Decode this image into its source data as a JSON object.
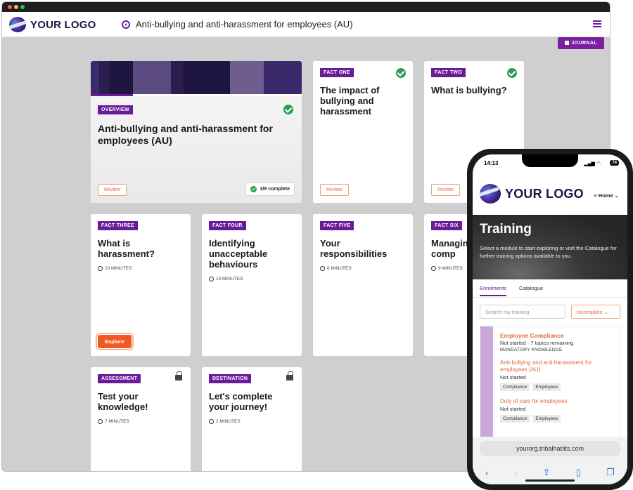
{
  "app": {
    "logo_text": "YOUR LOGO",
    "course_title": "Anti-bullying and anti-harassment for employees (AU)",
    "journal_label": "JOURNAL"
  },
  "cards": [
    {
      "tag": "OVERVIEW",
      "title": "Anti-bullying and anti-harassment for employees (AU)",
      "action": "Review",
      "status": "3/9 complete"
    },
    {
      "tag": "FACT ONE",
      "title": "The impact of bullying and harassment",
      "action": "Review"
    },
    {
      "tag": "FACT TWO",
      "title": "What is bullying?",
      "action": "Review"
    },
    {
      "tag": "FACT THREE",
      "title": "What is harassment?",
      "duration": "10 MINUTES",
      "action": "Explore"
    },
    {
      "tag": "FACT FOUR",
      "title": "Identifying unacceptable behaviours",
      "duration": "10 MINUTES"
    },
    {
      "tag": "FACT FIVE",
      "title": "Your responsibilities",
      "duration": "6 MINUTES"
    },
    {
      "tag": "FACT SIX",
      "title": "Managing and comp",
      "duration": "9 MINUTES"
    },
    {
      "tag": "ASSESSMENT",
      "title": "Test your knowledge!",
      "duration": "7 MINUTES"
    },
    {
      "tag": "DESTINATION",
      "title": "Let's complete your journey!",
      "duration": "2 MINUTES"
    }
  ],
  "phone": {
    "time": "14:13",
    "battery": "74",
    "logo_text": "YOUR LOGO",
    "home_label": "Home",
    "hero_title": "Training",
    "hero_text": "Select a module to start exploring or visit the Catalogue for further training options available to you.",
    "tabs": [
      "Enrolments",
      "Catalogue"
    ],
    "search_placeholder": "Search my training",
    "filter_label": "Incomplete",
    "enrolment": {
      "title": "Employee Compliance",
      "status": "Not started · 7 topics remaining",
      "category": "MANDATORY KNOWLEDGE",
      "courses": [
        {
          "name": "Anti-bullying and anti-harassment for employees (AU)",
          "status": "Not started",
          "chips": [
            "Compliance",
            "Employees"
          ]
        },
        {
          "name": "Duty of care for employees",
          "status": "Not started",
          "chips": [
            "Compliance",
            "Employees"
          ]
        }
      ]
    },
    "url": "yourorg.tribalhabits.com"
  }
}
